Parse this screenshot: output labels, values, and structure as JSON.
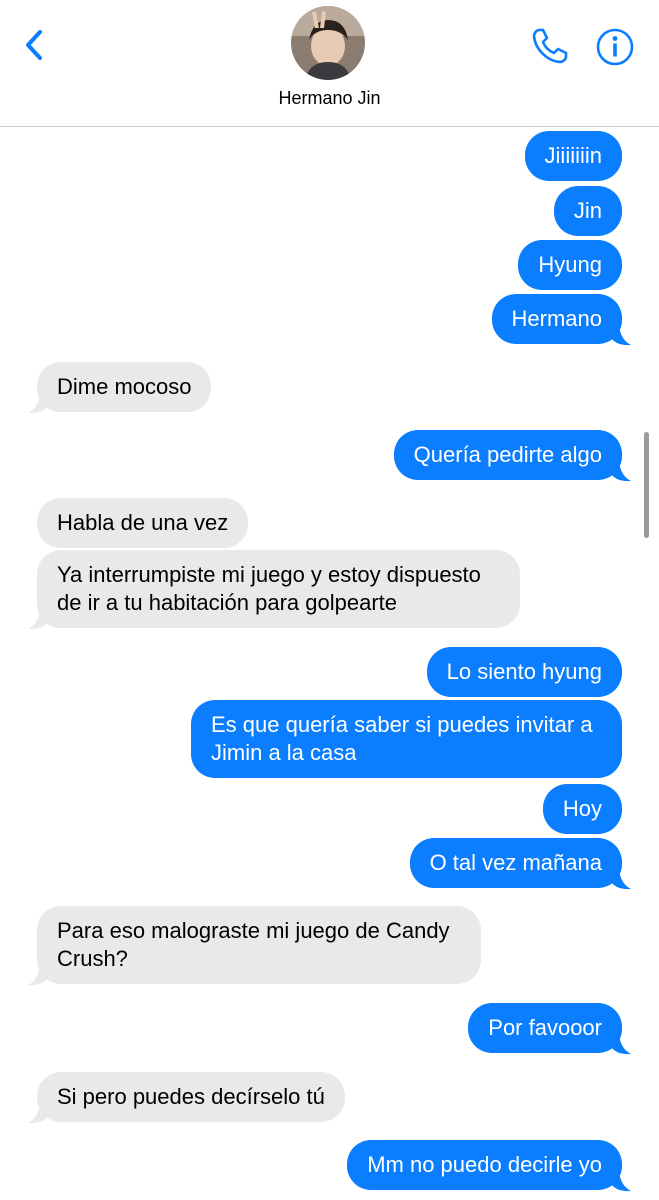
{
  "header": {
    "contact_name": "Hermano Jin",
    "back_icon": "chevron-left-icon",
    "call_icon": "phone-icon",
    "info_icon": "info-icon"
  },
  "colors": {
    "accent": "#0b7dff",
    "sent_bubble": "#0b7dff",
    "received_bubble": "#e9e9eb"
  },
  "messages": [
    {
      "direction": "sent",
      "text": "Jiiiiiiin"
    },
    {
      "direction": "sent",
      "text": "Jin"
    },
    {
      "direction": "sent",
      "text": "Hyung"
    },
    {
      "direction": "sent",
      "text": "Hermano"
    },
    {
      "direction": "received",
      "text": "Dime mocoso"
    },
    {
      "direction": "sent",
      "text": "Quería pedirte algo"
    },
    {
      "direction": "received",
      "text": "Habla de una vez"
    },
    {
      "direction": "received",
      "text": "Ya interrumpiste mi juego y estoy dispuesto de ir a tu habitación para golpearte"
    },
    {
      "direction": "sent",
      "text": "Lo siento hyung"
    },
    {
      "direction": "sent",
      "text": "Es que quería saber si puedes invitar a Jimin a la casa"
    },
    {
      "direction": "sent",
      "text": "Hoy"
    },
    {
      "direction": "sent",
      "text": "O tal vez mañana"
    },
    {
      "direction": "received",
      "text": "Para eso malograste mi juego de Candy Crush?"
    },
    {
      "direction": "sent",
      "text": "Por favooor"
    },
    {
      "direction": "received",
      "text": "Si pero puedes decírselo tú"
    },
    {
      "direction": "sent",
      "text": "Mm no puedo decirle yo"
    }
  ]
}
